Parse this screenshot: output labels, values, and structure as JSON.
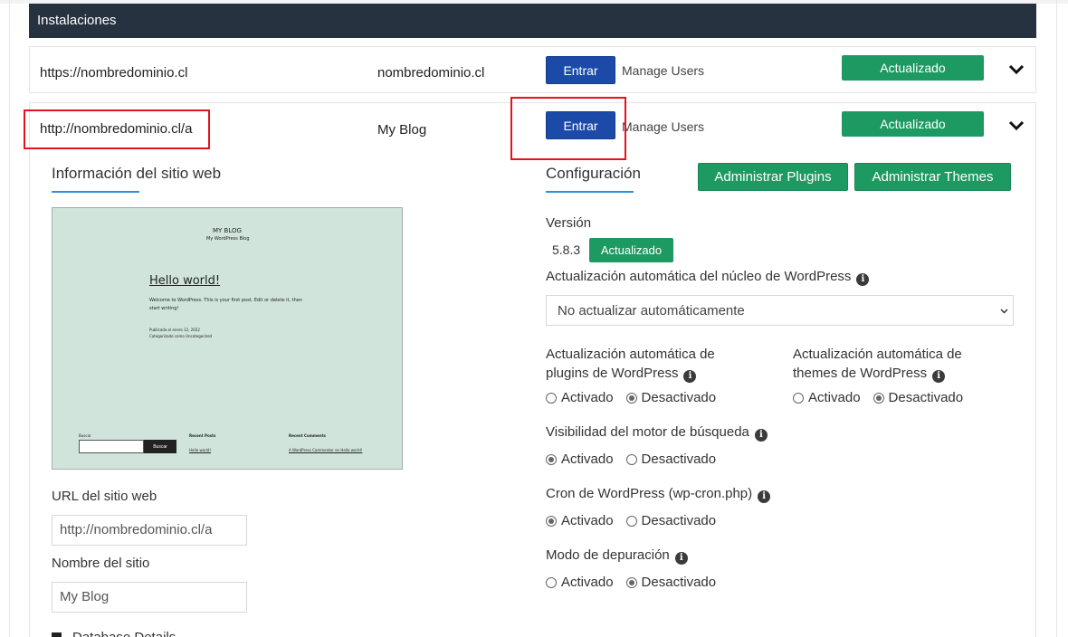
{
  "header": {
    "title": "Instalaciones"
  },
  "installations": [
    {
      "url": "https://nombredominio.cl",
      "name": "nombredominio.cl",
      "enter_label": "Entrar",
      "manage_label": "Manage Users",
      "status": "Actualizado"
    },
    {
      "url": "http://nombredominio.cl/a",
      "name": "My Blog",
      "enter_label": "Entrar",
      "manage_label": "Manage Users",
      "status": "Actualizado"
    }
  ],
  "site_info": {
    "title": "Información del sitio web",
    "preview": {
      "blog_title": "MY BLOG",
      "blog_tagline": "My WordPress Blog",
      "post_title": "Hello world!",
      "post_body_1": "Welcome to WordPress. This is your first post. Edit or delete it, then",
      "post_body_2": "start writing!",
      "post_meta_1": "Publicada el enero 12, 2022",
      "post_meta_2": "Categorizado como Uncategorized",
      "search_label": "Buscar",
      "search_button": "Buscar",
      "recent_posts_title": "Recent Posts",
      "recent_posts_item": "Hello world!",
      "recent_comments_title": "Recent Comments",
      "recent_comments_item": "A WordPress Commenter en Hello world!"
    },
    "url_label": "URL del sitio web",
    "url_value": "http://nombredominio.cl/a",
    "name_label": "Nombre del sitio",
    "name_value": "My Blog",
    "db_details_label": "Database Details"
  },
  "config": {
    "title": "Configuración",
    "plugins_button": "Administrar Plugins",
    "themes_button": "Administrar Themes",
    "version_label": "Versión",
    "version_value": "5.8.3",
    "version_status": "Actualizado",
    "core_update_label": "Actualización automática del núcleo de WordPress",
    "core_update_value": "No actualizar automáticamente",
    "plugins_update_label_1": "Actualización automática de",
    "plugins_update_label_2": "plugins de WordPress",
    "themes_update_label_1": "Actualización automática de",
    "themes_update_label_2": "themes de WordPress",
    "search_engine_label": "Visibilidad del motor de búsqueda",
    "cron_label": "Cron de WordPress (wp-cron.php)",
    "debug_label": "Modo de depuración",
    "on_label": "Activado",
    "off_label": "Desactivado",
    "info_glyph": "i"
  }
}
